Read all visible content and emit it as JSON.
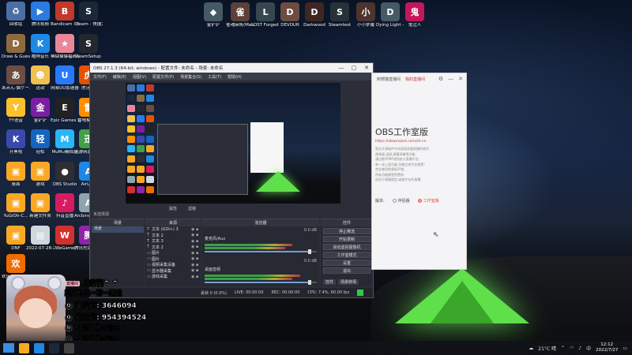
{
  "desktop": {
    "icons": [
      {
        "label": "回收站",
        "glyph": "♻",
        "color": "#4a6fa5"
      },
      {
        "label": "腾讯视频",
        "glyph": "▶",
        "color": "#2a7ae2"
      },
      {
        "label": "Bandicam - 快捷方式",
        "glyph": "B",
        "color": "#c0392b"
      },
      {
        "label": "Steam - 快捷方式",
        "glyph": "S",
        "color": "#1b2838"
      },
      {
        "label": "Draw & Guess",
        "glyph": "D",
        "color": "#8e6b3e"
      },
      {
        "label": "酷狗音乐",
        "glyph": "K",
        "color": "#1e88e5"
      },
      {
        "label": "稀缺猫爆福利站",
        "glyph": "★",
        "color": "#e8879a"
      },
      {
        "label": "SteamSetup - 快捷方式",
        "glyph": "S",
        "color": "#23272e"
      },
      {
        "label": "あみん-猫ゲームセンター",
        "glyph": "あ",
        "color": "#6d4c41"
      },
      {
        "label": "运动",
        "glyph": "☻",
        "color": "#f0c050"
      },
      {
        "label": "网易UU加速器",
        "glyph": "U",
        "color": "#2979ff"
      },
      {
        "label": "虎牙TV",
        "glyph": "虎",
        "color": "#e65100"
      },
      {
        "label": "YY语音",
        "glyph": "Y",
        "color": "#fbc02d"
      },
      {
        "label": "金铲铲",
        "glyph": "金",
        "color": "#7b1fa2"
      },
      {
        "label": "Epic Games Launcher",
        "glyph": "E",
        "color": "#222222"
      },
      {
        "label": "雷电模拟器",
        "glyph": "雷",
        "color": "#ff8f00"
      },
      {
        "label": "开黑啦",
        "glyph": "K",
        "color": "#3949ab"
      },
      {
        "label": "轻松",
        "glyph": "轻",
        "color": "#1565c0"
      },
      {
        "label": "MuMu模拟器",
        "glyph": "M",
        "color": "#29b6f6"
      },
      {
        "label": "迅游网游加速器",
        "glyph": "迅",
        "color": "#43a047"
      },
      {
        "label": "桌面",
        "glyph": "▣",
        "color": "#f9a825"
      },
      {
        "label": "游戏",
        "glyph": "▣",
        "color": "#f9a825"
      },
      {
        "label": "OBS Studio",
        "glyph": "●",
        "color": "#302e31"
      },
      {
        "label": "AirLink",
        "glyph": "A",
        "color": "#1e88e5"
      },
      {
        "label": "YuGiOh-C...",
        "glyph": "▣",
        "color": "#f9a825"
      },
      {
        "label": "新建文件夹",
        "glyph": "▣",
        "color": "#f9a825"
      },
      {
        "label": "抖音直播",
        "glyph": "♪",
        "color": "#d81b60"
      },
      {
        "label": "Arcbine Proxee",
        "glyph": "A",
        "color": "#90a4ae"
      },
      {
        "label": "DNF",
        "glyph": "▣",
        "color": "#f9a825"
      },
      {
        "label": "2022-07-28-2...",
        "glyph": "▤",
        "color": "#cfd8dc"
      },
      {
        "label": "WeGame",
        "glyph": "W",
        "color": "#d32f2f"
      },
      {
        "label": "腾讯先锋云游戏",
        "glyph": "腾",
        "color": "#8e24aa"
      },
      {
        "label": "欢乐斗地主-多模态",
        "glyph": "欢",
        "color": "#ef6c00"
      }
    ],
    "top_icons": [
      {
        "label": "金铲铲",
        "glyph": "◆",
        "color": "#455a64"
      },
      {
        "label": "雀魂麻将(Mahjong...",
        "glyph": "雀",
        "color": "#5d4037"
      },
      {
        "label": "LOST Forged ...",
        "glyph": "L",
        "color": "#37474f"
      },
      {
        "label": "DEVOUR",
        "glyph": "D",
        "color": "#6d4c41"
      },
      {
        "label": "Darkwood",
        "glyph": "D",
        "color": "#3e2723"
      },
      {
        "label": "Steamtest",
        "glyph": "S",
        "color": "#263238"
      },
      {
        "label": "小小梦魇",
        "glyph": "小",
        "color": "#4e342e"
      },
      {
        "label": "Dying Light - 快捷方式",
        "glyph": "D",
        "color": "#455a64"
      },
      {
        "label": "鬼泣人",
        "glyph": "鬼",
        "color": "#c2185b"
      }
    ]
  },
  "obs": {
    "title": "OBS 27.1.3 (64-bit, windows) - 配置文件: 未命名 - 场景: 未命名",
    "menu": [
      "文件(F)",
      "编辑(E)",
      "视图(V)",
      "配置文件(P)",
      "场景集合(S)",
      "工具(T)",
      "帮助(H)"
    ],
    "preview_bar": [
      "属性",
      "滤镜"
    ],
    "scenes_header": "场景",
    "scenes": [
      "场景"
    ],
    "no_source": "未选择源",
    "sources_header": "来源",
    "sources": [
      {
        "type": "T",
        "name": "文本 (GDI+) 3"
      },
      {
        "type": "T",
        "name": "文本 2"
      },
      {
        "type": "T",
        "name": "文本 3"
      },
      {
        "type": "T",
        "name": "文本 2"
      },
      {
        "type": "▭",
        "name": "图片"
      },
      {
        "type": "▭",
        "name": "图片"
      },
      {
        "type": "▭",
        "name": "视频采集设备"
      },
      {
        "type": "▭",
        "name": "显示器采集"
      },
      {
        "type": "▭",
        "name": "游戏采集"
      }
    ],
    "mixer_header": "混音器",
    "mixer": [
      {
        "name": "麦克风/Aux",
        "db": "0.0 dB",
        "level": 0.78
      },
      {
        "name": "桌面音频",
        "db": "0.0 dB",
        "level": 0.85
      }
    ],
    "controls_header": "控件",
    "controls": [
      "停止推流",
      "开始录制",
      "启动虚拟摄像机",
      "工作室模式",
      "设置",
      "退出"
    ],
    "control_tabs": [
      "控件",
      "场景转场"
    ],
    "status": [
      "丢帧 0 (0.0%)",
      "LIVE: 00:00:00",
      "REC: 00:00:00",
      "CPU: 7.4%, 60.00 fps"
    ]
  },
  "panel": {
    "header_tabs": [
      "刺猬猫直播间",
      "我的直播间"
    ],
    "title": "OBS工作室版",
    "subtitle": "https://obsproject.com/zh-cn",
    "lines": [
      "是在开源软件中实现高质量直播的软件,",
      "视频源,录屏,屏幕采集等功能,",
      "通过推RTMP流到各大直播平台,",
      "单一化上面功能,功能比较专业推荐!",
      "完全使用效果很不错,",
      "所有功能都是免费的,",
      "适合于想要稳定,或者专业的直播."
    ],
    "radio_label": "版本:",
    "radio_options": [
      "伴侣版",
      "工作室版"
    ]
  },
  "overlay": {
    "line1": "上房管^ ^",
    "line2": "加群和我一种一起玩",
    "line3_label": "直播群:",
    "line3_value": "3646094",
    "line4_label": "粉丝群:",
    "line4_value": "954394524",
    "line5": "刺猬猫爱大魔王",
    "line6": "刺猬猫爱大魔王",
    "badge": "直播间"
  },
  "taskbar": {
    "weather": "21°C 晴",
    "ime": "中",
    "time": "12:12",
    "date": "2022/7/27",
    "apps": [
      {
        "name": "start",
        "color": "#3a8ee6"
      },
      {
        "name": "explorer",
        "color": "#f9a825"
      },
      {
        "name": "edge",
        "color": "#1e88e5"
      },
      {
        "name": "steam",
        "color": "#1b2838"
      },
      {
        "name": "obs",
        "color": "#444444"
      }
    ]
  }
}
